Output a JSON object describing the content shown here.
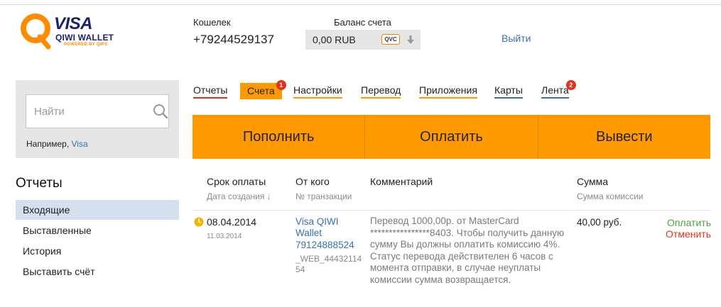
{
  "logo": {
    "visa": "VISA",
    "qiwi_wallet": "QIWI WALLET",
    "powered": "POWERED BY QIPS"
  },
  "header": {
    "wallet_label": "Кошелек",
    "wallet_phone": "+79244529137",
    "balance_label": "Баланс счета",
    "balance_value": "0,00 RUB",
    "balance_currency_badge": "QVC",
    "logout_label": "Выйти"
  },
  "search": {
    "placeholder": "Найти",
    "hint_prefix": "Например, ",
    "hint_example": "Visa"
  },
  "sidebar": {
    "title": "Отчеты",
    "items": [
      {
        "label": "Входящие",
        "active": true
      },
      {
        "label": "Выставленные",
        "active": false
      },
      {
        "label": "История",
        "active": false
      },
      {
        "label": "Выставить счёт",
        "active": false
      }
    ]
  },
  "tabs": [
    {
      "label": "Отчеты",
      "underline": "#e4311c"
    },
    {
      "label": "Счета",
      "active": true,
      "badge": "1"
    },
    {
      "label": "Настройки",
      "underline": "#ff9900"
    },
    {
      "label": "Перевод",
      "underline": "#ff9900"
    },
    {
      "label": "Приложения",
      "underline": "#ff9900"
    },
    {
      "label": "Карты",
      "underline": "#3a6fb5"
    },
    {
      "label": "Лента",
      "underline": "#3a6fb5",
      "badge": "2"
    }
  ],
  "actions": {
    "topup": "Пополнить",
    "pay": "Оплатить",
    "withdraw": "Вывести"
  },
  "table": {
    "col_due": "Срок оплаты",
    "col_due_sub": "Дата создания ↓",
    "col_from": "От кого",
    "col_from_sub": "№ транзакции",
    "col_comment": "Комментарий",
    "col_sum": "Сумма",
    "col_sum_sub": "Сумма комиссии",
    "rows": [
      {
        "due_date": "08.04.2014",
        "created_date": "11.03.2014",
        "from_name": "Visa QIWI Wallet",
        "from_phone": "79124888524",
        "transaction": "_WEB_44432114 54",
        "comment": "Перевод 1000,00р. от MasterCard ****************8403. Чтобы получить данную сумму Вы должны оплатить комиссию 4%. Статус перевода действителен 6 часов с момента отправки, в случае неуплаты комиссии сумма возвращается.",
        "amount": "40,00 руб.",
        "pay_label": "Оплатить",
        "cancel_label": "Отменить"
      }
    ]
  },
  "colors": {
    "accent": "#ff9900",
    "link": "#3a6fb5",
    "danger": "#e4311c",
    "success": "#4aa33d",
    "brand_navy": "#1a1f71"
  }
}
